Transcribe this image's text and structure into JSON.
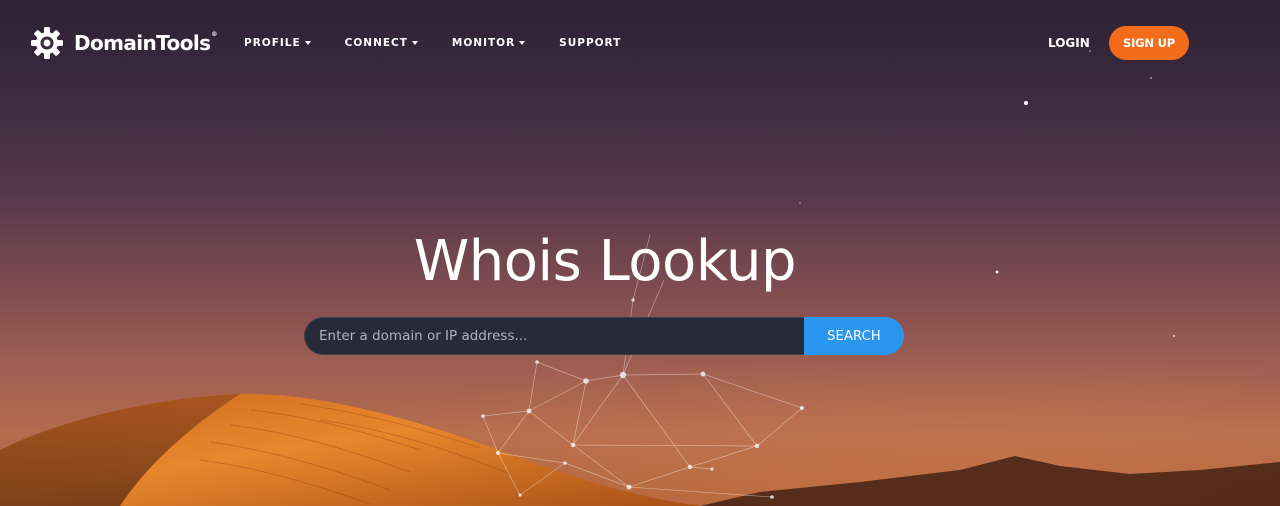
{
  "brand": {
    "name": "DomainTools",
    "trademark": "®"
  },
  "nav": {
    "items": [
      {
        "label": "PROFILE",
        "has_dropdown": true
      },
      {
        "label": "CONNECT",
        "has_dropdown": true
      },
      {
        "label": "MONITOR",
        "has_dropdown": true
      },
      {
        "label": "SUPPORT",
        "has_dropdown": false
      }
    ],
    "login_label": "LOGIN",
    "signup_label": "SIGN UP"
  },
  "hero": {
    "title": "Whois Lookup"
  },
  "search": {
    "placeholder": "Enter a domain or IP address...",
    "value": "",
    "button_label": "SEARCH"
  },
  "colors": {
    "signup_bg": "#f26c1b",
    "search_button_bg": "#2a96f0",
    "search_input_bg": "#262b38"
  },
  "icons": {
    "logo": "gear-icon",
    "dropdown": "caret-down-icon"
  }
}
